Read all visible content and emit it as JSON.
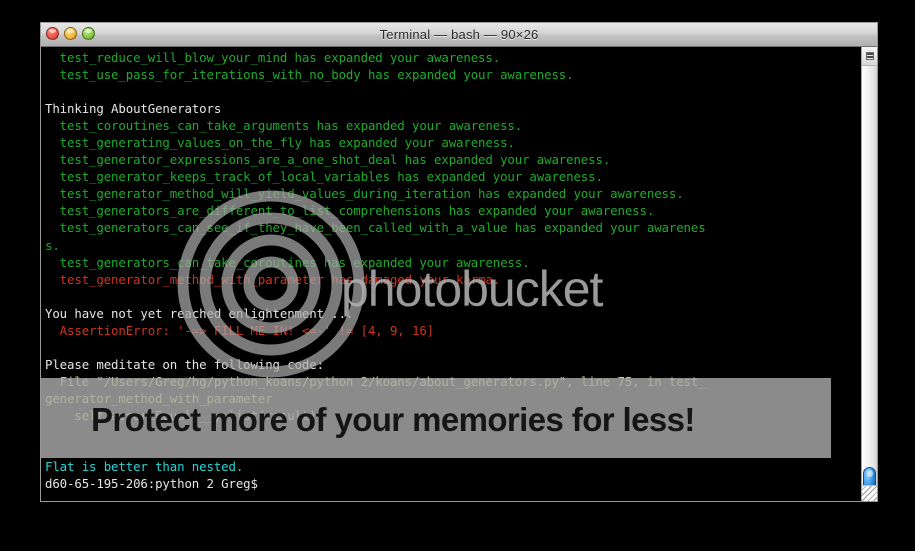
{
  "window": {
    "title": "Terminal — bash — 90×26",
    "controls": [
      {
        "name": "close",
        "color": "#e8503f"
      },
      {
        "name": "minimize",
        "color": "#f0b32f"
      },
      {
        "name": "zoom",
        "color": "#7fc240"
      }
    ]
  },
  "colors": {
    "green": "#1faa2d",
    "red": "#d0341e",
    "white": "#e6e6e6",
    "yellow": "#d6cc70",
    "cyan": "#26d6d6",
    "background": "#000000",
    "watermark_gray": "#aaaaaa"
  },
  "terminal": {
    "lines": [
      {
        "text": "  test_reduce_will_blow_your_mind has expanded your awareness.",
        "color": "green"
      },
      {
        "text": "  test_use_pass_for_iterations_with_no_body has expanded your awareness.",
        "color": "green"
      },
      {
        "text": "",
        "color": "white"
      },
      {
        "text": "Thinking AboutGenerators",
        "color": "white"
      },
      {
        "text": "  test_coroutines_can_take_arguments has expanded your awareness.",
        "color": "green"
      },
      {
        "text": "  test_generating_values_on_the_fly has expanded your awareness.",
        "color": "green"
      },
      {
        "text": "  test_generator_expressions_are_a_one_shot_deal has expanded your awareness.",
        "color": "green"
      },
      {
        "text": "  test_generator_keeps_track_of_local_variables has expanded your awareness.",
        "color": "green"
      },
      {
        "text": "  test_generator_method_will_yield_values_during_iteration has expanded your awareness.",
        "color": "green"
      },
      {
        "text": "  test_generators_are_different_to_list_comprehensions has expanded your awareness.",
        "color": "green"
      },
      {
        "text": "  test_generators_can_see_if_they_have_been_called_with_a_value has expanded your awarenes",
        "color": "green"
      },
      {
        "text": "s.",
        "color": "green"
      },
      {
        "text": "  test_generators_can_take_coroutines has expanded your awareness.",
        "color": "green"
      },
      {
        "text": "  test_generator_method_with_parameter has damaged your karma.",
        "color": "red"
      },
      {
        "text": "",
        "color": "white"
      },
      {
        "text": "You have not yet reached enlightenment ...",
        "color": "white"
      },
      {
        "text": "  AssertionError: '-=> FILL ME IN! <=-' != [4, 9, 16]",
        "color": "red"
      },
      {
        "text": "",
        "color": "white"
      },
      {
        "text": "Please meditate on the following code:",
        "color": "white"
      },
      {
        "text": "  File \"/Users/Greg/hg/python_koans/python 2/koans/about_generators.py\", line 75, in test_",
        "color": "yellow"
      },
      {
        "text": "generator_method_with_parameter",
        "color": "yellow"
      },
      {
        "text": "    self.assertEqual(__, list(result))",
        "color": "yellow"
      },
      {
        "text": "",
        "color": "white"
      },
      {
        "text": "",
        "color": "white"
      },
      {
        "text": "Flat is better than nested.",
        "color": "cyan"
      },
      {
        "text": "d60-65-195-206:python 2 Greg$",
        "color": "white"
      }
    ]
  },
  "watermark": {
    "brand": "photobucket",
    "tagline": "Protect more of your memories for less!"
  },
  "scrollbar": {
    "top_button": "scroll-mode-button",
    "up_arrow": "▲",
    "down_arrow": "▼"
  }
}
